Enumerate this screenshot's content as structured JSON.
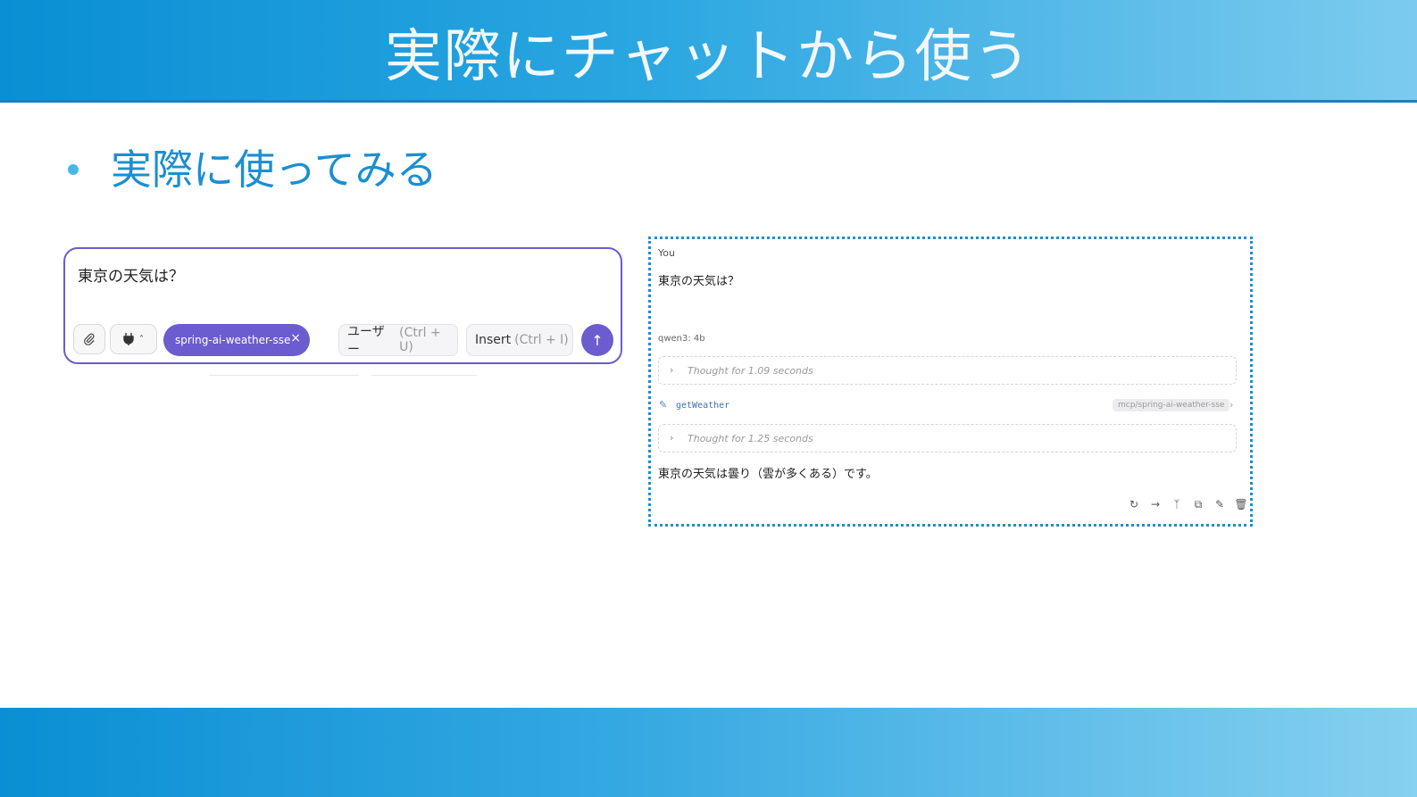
{
  "slide": {
    "title": "実際にチャットから使う",
    "bullet": "実際に使ってみる"
  },
  "composer": {
    "input_value": "東京の天気は？",
    "attach_icon": "paperclip-icon",
    "tools_icon": "plug-icon",
    "tools_chevron": "chevron-up-icon",
    "tool_chip_label": "spring-ai-weather-sse",
    "tool_chip_remove": "×",
    "user_mode_label": "ユーザー",
    "user_mode_hint": "(Ctrl + U)",
    "insert_label": "Insert",
    "insert_hint": "(Ctrl + I)",
    "send_icon": "arrow-up-icon"
  },
  "chat": {
    "user_name": "You",
    "user_message": "東京の天気は？",
    "model_name": "qwen3: 4b",
    "thought1": "Thought for 1.09 seconds",
    "tool_name": "getWeather",
    "tool_source": "mcp/spring-ai-weather-sse",
    "thought2": "Thought for 1.25 seconds",
    "answer": "東京の天気は曇り（雲が多くある）です。",
    "action_icons": [
      "regenerate-icon",
      "continue-icon",
      "branch-icon",
      "copy-icon",
      "edit-icon",
      "delete-icon"
    ]
  },
  "colors": {
    "header_start": "#0a8fd4",
    "header_end": "#7ccbee",
    "accent_purple": "#6b5ccf",
    "bullet_text": "#1a8fd1"
  }
}
